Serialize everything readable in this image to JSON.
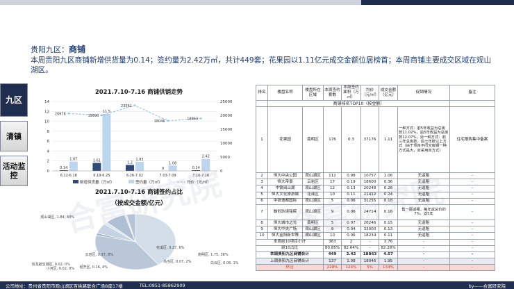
{
  "page": {
    "region": "贵阳九区：",
    "section": "商铺",
    "summary": "本周贵阳九区商铺新增供货量为0.14；签约量为2.42万㎡，共计449套；花果园以1.11亿元成交金额位居榜首；本周商铺主要成交区域在观山湖区。"
  },
  "sidebar": {
    "items": [
      {
        "label": "九区",
        "active": true
      },
      {
        "label": "清镇",
        "active": false
      },
      {
        "label": "活动监控",
        "active": false
      }
    ]
  },
  "watermark": {
    "text": "合富研究院"
  },
  "colors": {
    "supply": "#2e4a7a",
    "signed": "#bcd6ee",
    "price": "#9cc3e6",
    "pct_row": "#c0392b"
  },
  "chart_data": [
    {
      "type": "bar",
      "title": "2021.7.10-7.16  商铺供销走势",
      "categories": [
        "6.12-6.18",
        "6.19-6.25",
        "6.26-7.02",
        "7.03-7.09",
        "7.10-7.16"
      ],
      "left_axis": {
        "ylim": [
          0,
          14
        ],
        "ticks": [
          "0",
          "2",
          "4",
          "6",
          "8",
          "10",
          "12",
          "14"
        ]
      },
      "right_axis": {
        "ylim": [
          0,
          25000
        ],
        "ticks": [
          "0",
          "5000",
          "10000",
          "15000",
          "20000",
          "25000"
        ]
      },
      "series": [
        {
          "name": "新增供货量（万㎡）",
          "kind": "bar",
          "values": [
            0.14,
            1.61,
            1.2,
            0,
            0.14
          ],
          "labels": [
            "0.14",
            "1.61",
            "1.2",
            "0",
            "0.14"
          ]
        },
        {
          "name": "签约量（万㎡）",
          "kind": "bar",
          "values": [
            1.87,
            11.5,
            1.83,
            1.08,
            2.42
          ],
          "labels": [
            "1.87",
            "11.5",
            "1.83",
            "1.08",
            "2.42"
          ]
        },
        {
          "name": "均价（元/㎡）",
          "kind": "line",
          "axis": "right",
          "values": [
            20678,
            19990,
            23561,
            18046,
            18863
          ],
          "labels": [
            "20678",
            "19990",
            "23561",
            "18046",
            "18863"
          ]
        }
      ],
      "legend": "bottom"
    },
    {
      "type": "pie",
      "title": "2021.7.10-7.16  商铺签约占比",
      "subtitle": "（按成交金额/亿元）",
      "slices": [
        {
          "name": "观山湖区",
          "value": 1.84,
          "pct": "40%",
          "label": "观山湖区, 1.84, 40%"
        },
        {
          "name": "南明区",
          "value": 1.75,
          "pct": "38%",
          "label": "南明区, 1.75, 38%"
        },
        {
          "name": "白云区",
          "value": 0.06,
          "pct": "1%",
          "label": "白云区, 0.06, 1%"
        },
        {
          "name": "花溪区",
          "value": 0.27,
          "pct": "6%",
          "label": "花溪区, 0.27, 6%"
        },
        {
          "name": "乌当区",
          "value": 0.07,
          "pct": "2%",
          "label": "乌当区, 0.07, 2%"
        },
        {
          "name": "云岩区",
          "value": 0.37,
          "pct": "8%",
          "label": "云岩区, 0.37, 8%"
        },
        {
          "name": "双龙",
          "value": 0.02,
          "pct": "0%",
          "label": "双龙航空港区, 0.02, 0%"
        },
        {
          "name": "小河区",
          "value": 0.02,
          "pct": "0%",
          "label": "小河区, 0.02, 0%"
        },
        {
          "name": "经开区",
          "value": 0.16,
          "pct": "4%",
          "label": "经开区, 0.16, 4%"
        }
      ]
    }
  ],
  "table": {
    "caption": "商铺排名TOP10（按金额）",
    "headers": [
      "排名",
      "楼盘名称",
      "楼盘所在区域",
      "本周签约套数",
      "本周签约面积（万㎡）",
      "均价（元/㎡）",
      "成交金额（亿元）",
      "促销情况",
      "备注"
    ],
    "rows": [
      [
        "1",
        "花果园",
        "南明区",
        "176",
        "0.3",
        "37176",
        "1.11",
        "一种方式：前5年收益为总房款11.02%，后5年收益为总房款12.07%，另一种方式：前三年总房款，后七年按以上方式（由于项目不同交房期一种方式是大，双采用双方式）",
        "住宅限购集中备案"
      ],
      [
        "2",
        "恒大中央公园",
        "观山湖区",
        "112",
        "0.98",
        "10757",
        "1.06",
        "无返租",
        "-"
      ],
      [
        "3",
        "恒大帝景",
        "云岩区",
        "17",
        "0.19",
        "18600",
        "0.36",
        "无返租",
        "-"
      ],
      [
        "4",
        "中铁阅山湖",
        "观山湖区",
        "12",
        "0.13",
        "20248",
        "0.26",
        "无返租",
        "-"
      ],
      [
        "5",
        "恒大文化旅游城",
        "花溪区",
        "10",
        "0.11",
        "21412",
        "0.24",
        "无返租",
        "-"
      ],
      [
        "6",
        "中铁逸都国际",
        "观山湖区",
        "5",
        "0.06",
        "31255",
        "0.18",
        "无返租",
        "-"
      ],
      [
        "7",
        "融创玖境铭院",
        "观山湖区",
        "9",
        "0.06",
        "24714",
        "0.16",
        "售一层返租，每年返总价的7%，返5年",
        "-"
      ],
      [
        "8",
        "恒大城市之光",
        "南明区",
        "5",
        "0.07",
        "20246",
        "0.15",
        "无返租",
        "-"
      ],
      [
        "9",
        "恒大中央广场",
        "观山湖区",
        "9",
        "0.04",
        "33000",
        "0.13",
        "无返租",
        "-"
      ],
      [
        "10",
        "恒大金阳新世界",
        "观山湖区",
        "10",
        "0.06",
        "18234",
        "0.11",
        "无返租",
        "-"
      ]
    ],
    "summary_rows": [
      {
        "label": "本周前10项目小计",
        "values": [
          "363",
          "2",
          "-",
          "3.76",
          "-",
          "-"
        ],
        "style": "plain"
      },
      {
        "label": "前10占比",
        "values": [
          "80.85%",
          "82.64%",
          "-",
          "82.28%",
          "-",
          "-"
        ],
        "style": "plain"
      },
      {
        "label": "本周贵阳九区商铺合计",
        "values": [
          "449",
          "2.42",
          "18863",
          "4.57",
          "-",
          "-"
        ],
        "style": "bold"
      },
      {
        "label": "上周贵阳九区商铺合计",
        "values": [
          "137",
          "1.08",
          "18046",
          "1.95",
          "-",
          "-"
        ],
        "style": "compare"
      },
      {
        "label": "环比",
        "values": [
          "228%",
          "124%",
          "5%",
          "134%",
          "-",
          "-"
        ],
        "style": "pct"
      }
    ]
  },
  "footer": {
    "address": "公司地址：贵州省贵阳市观山湖区百挑路联合广场B座17楼",
    "tel": "TEL:0851-85862909",
    "brand": "by——合富研究院"
  }
}
